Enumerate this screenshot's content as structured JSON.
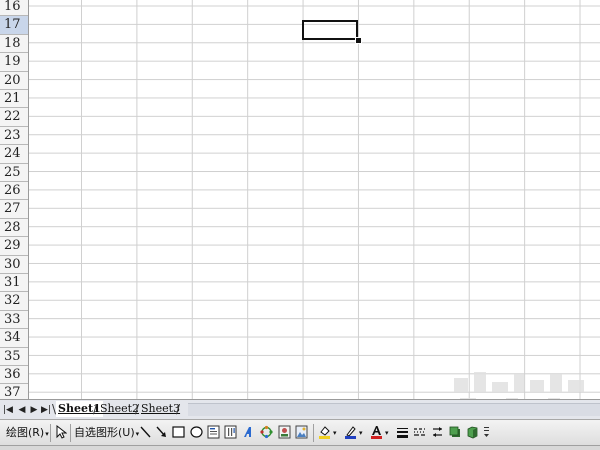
{
  "grid": {
    "rows": [
      "16",
      "17",
      "18",
      "19",
      "20",
      "21",
      "22",
      "23",
      "24",
      "25",
      "26",
      "27",
      "28",
      "29",
      "30",
      "31",
      "32",
      "33",
      "34",
      "35",
      "36",
      "37"
    ],
    "active_row": "17"
  },
  "sheet_tabs": [
    "Sheet1",
    "Sheet2",
    "Sheet3"
  ],
  "tab_nav": {
    "first": "|◀",
    "prev": "◀",
    "next": "▶",
    "last": "▶|"
  },
  "toolbar": {
    "draw_label": "绘图(R)",
    "autoshapes_label": "自选图形(U)",
    "dropdown_arrow": "▾"
  },
  "colors": {
    "fill_color": "#f0d020",
    "line_color": "#2040c0",
    "font_color": "#d02020",
    "active_row_header": "#c9d6ea"
  }
}
